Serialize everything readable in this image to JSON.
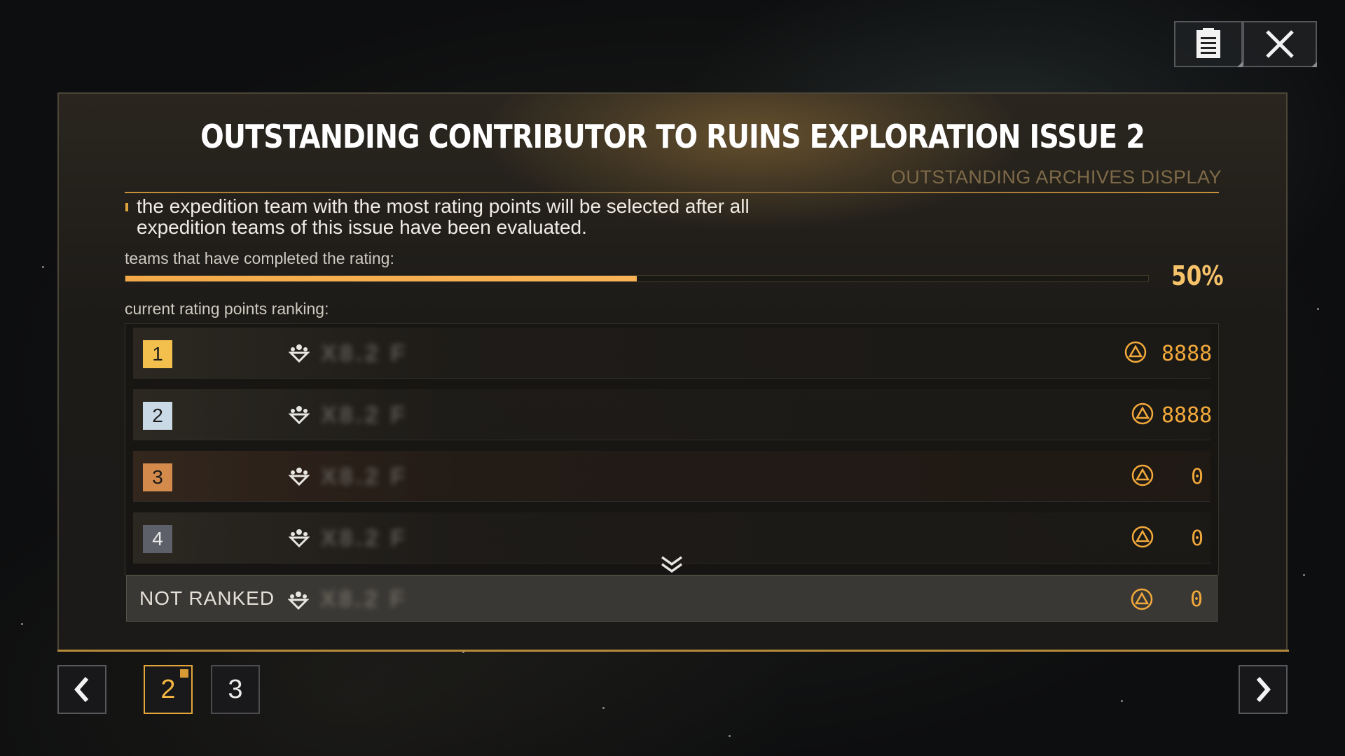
{
  "header": {
    "notes_icon": "clipboard-icon",
    "close_icon": "close-icon"
  },
  "panel": {
    "title": "OUTSTANDING CONTRIBUTOR TO RUINS EXPLORATION ISSUE 2",
    "subtitle": "OUTSTANDING ARCHIVES DISPLAY",
    "description": "the expedition team with the most rating points will be selected after all expedition teams of this issue have been evaluated.",
    "progress_label": "teams that have completed the rating:",
    "progress_percent": "50%",
    "progress_value": 0.5,
    "ranking_label": "current rating points ranking:"
  },
  "ranking": [
    {
      "rank": "1",
      "name": "X8.2 F",
      "points": "8888",
      "badge_color": "#f3c04e"
    },
    {
      "rank": "2",
      "name": "X8.2 F",
      "points": "8888",
      "badge_color": "#c9d9e6"
    },
    {
      "rank": "3",
      "name": "X8.2 F",
      "points": "0",
      "badge_color": "#d48a4a"
    },
    {
      "rank": "4",
      "name": "X8.2 F",
      "points": "0",
      "badge_color": "#5d6068"
    }
  ],
  "not_ranked": {
    "label": "NOT RANKED",
    "name": "X8.2 F",
    "points": "0"
  },
  "pagination": {
    "pages": [
      "2",
      "3"
    ],
    "active": "2"
  },
  "colors": {
    "accent": "#f3a948",
    "gold": "#f6c36a"
  }
}
